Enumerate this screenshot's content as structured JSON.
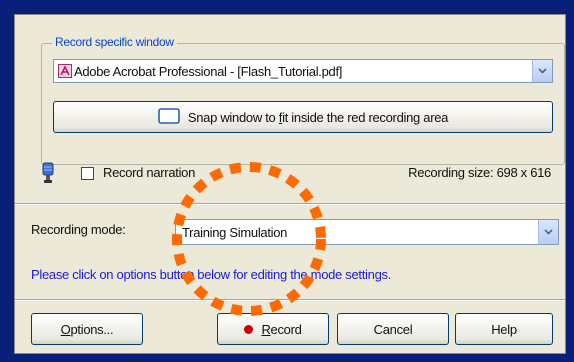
{
  "record_group": {
    "label": "Record specific window",
    "window_select": {
      "value": "Adobe Acrobat Professional - [Flash_Tutorial.pdf]",
      "icon": "acrobat-icon"
    },
    "snap_button_label_pre": "Snap window to ",
    "snap_button_label_mnemonic": "f",
    "snap_button_label_post": "it inside the red recording area"
  },
  "narration": {
    "icon": "microphone-icon",
    "checkbox_label": "Record narration",
    "checked": false
  },
  "recording_size": "Recording size: 698 x 616",
  "mode": {
    "label": "Recording mode:",
    "value": "Training Simulation",
    "hint": "Please click on options button below for editing the mode settings."
  },
  "buttons": {
    "options_mnemonic": "O",
    "options_rest": "ptions...",
    "record_mnemonic": "R",
    "record_rest": "ecord",
    "cancel": "Cancel",
    "help": "Help"
  },
  "colors": {
    "dialog_bg": "#ece9d8",
    "hint_text": "#1a1ae0",
    "record_dot": "#cc0000",
    "highlight_circle": "#ff6a00",
    "window_border": "#0a1f7a"
  }
}
